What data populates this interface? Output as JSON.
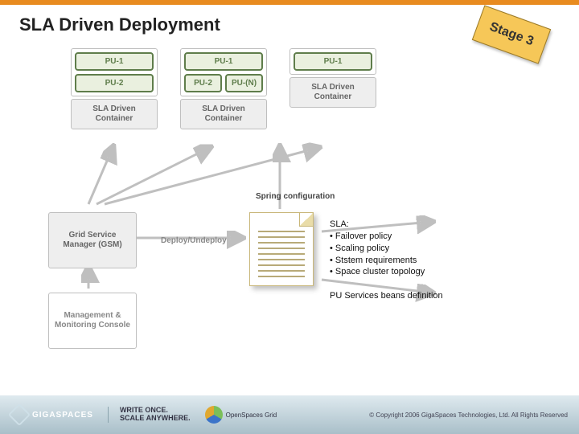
{
  "header": {
    "title": "SLA Driven Deployment"
  },
  "stage_badge": "Stage 3",
  "containers": [
    {
      "pu_top": "PU-1",
      "pu_left": "PU-2",
      "pu_right": "",
      "driver": "SLA Driven Container"
    },
    {
      "pu_top": "PU-1",
      "pu_left": "PU-2",
      "pu_right": "PU-(N)",
      "driver": "SLA Driven Container"
    },
    {
      "pu_top": "PU-1",
      "pu_left": "",
      "pu_right": "",
      "driver": "SLA Driven Container"
    }
  ],
  "gsm": "Grid Service Manager (GSM)",
  "console": "Management & Monitoring Console",
  "deploy_label": "Deploy/Undeploy",
  "spring_label": "Spring configuration",
  "sla_block": {
    "heading": "SLA:",
    "items": [
      "Failover policy",
      "Scaling policy",
      "Ststem requirements",
      "Space cluster topology"
    ]
  },
  "beans_text": "PU Services beans definition",
  "footer": {
    "brand": "GIGASPACES",
    "tagline_l1": "WRITE ONCE.",
    "tagline_l2": "SCALE ANYWHERE.",
    "osgrid": "OpenSpaces Grid",
    "copyright": "© Copyright 2006 GigaSpaces Technologies, Ltd. All Rights Reserved"
  }
}
